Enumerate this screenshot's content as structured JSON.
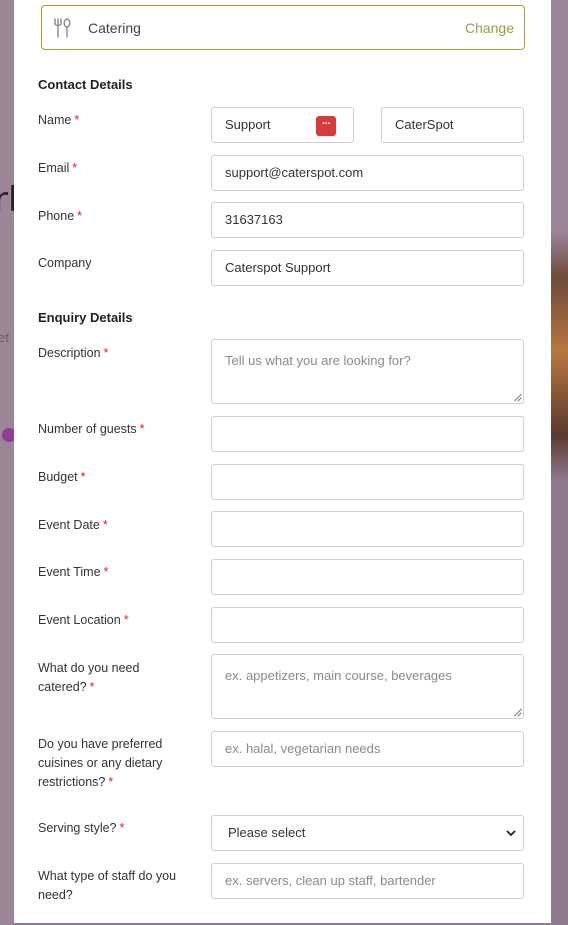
{
  "service": {
    "icon": "cutlery-icon",
    "label": "Catering",
    "change_label": "Change"
  },
  "background": {
    "partial_text": "rl",
    "partial_sub": "et"
  },
  "contact": {
    "title": "Contact Details",
    "name_label": "Name",
    "first_name": "Support",
    "last_name": "CaterSpot",
    "email_label": "Email",
    "email": "support@caterspot.com",
    "phone_label": "Phone",
    "phone": "31637163",
    "company_label": "Company",
    "company": "Caterspot Support"
  },
  "enquiry": {
    "title": "Enquiry Details",
    "description_label": "Description",
    "description_placeholder": "Tell us what you are looking for?",
    "guests_label": "Number of guests",
    "budget_label": "Budget",
    "date_label": "Event Date",
    "time_label": "Event Time",
    "location_label": "Event Location",
    "catered_label_1": "What do you need",
    "catered_label_2": "catered?",
    "catered_placeholder": "ex. appetizers, main course, beverages",
    "cuisine_label_1": "Do you have preferred",
    "cuisine_label_2": "cuisines or any dietary",
    "cuisine_label_3": "restrictions?",
    "cuisine_placeholder": "ex. halal, vegetarian needs",
    "serving_label": "Serving style?",
    "serving_value": "Please select",
    "staff_label_1": "What type of staff do you",
    "staff_label_2": "need?",
    "staff_placeholder": "ex. servers, clean up staff, bartender"
  },
  "required_mark": "*",
  "colors": {
    "accent": "#8aa63a",
    "required": "#e02020",
    "border": "#cfcfcf"
  }
}
